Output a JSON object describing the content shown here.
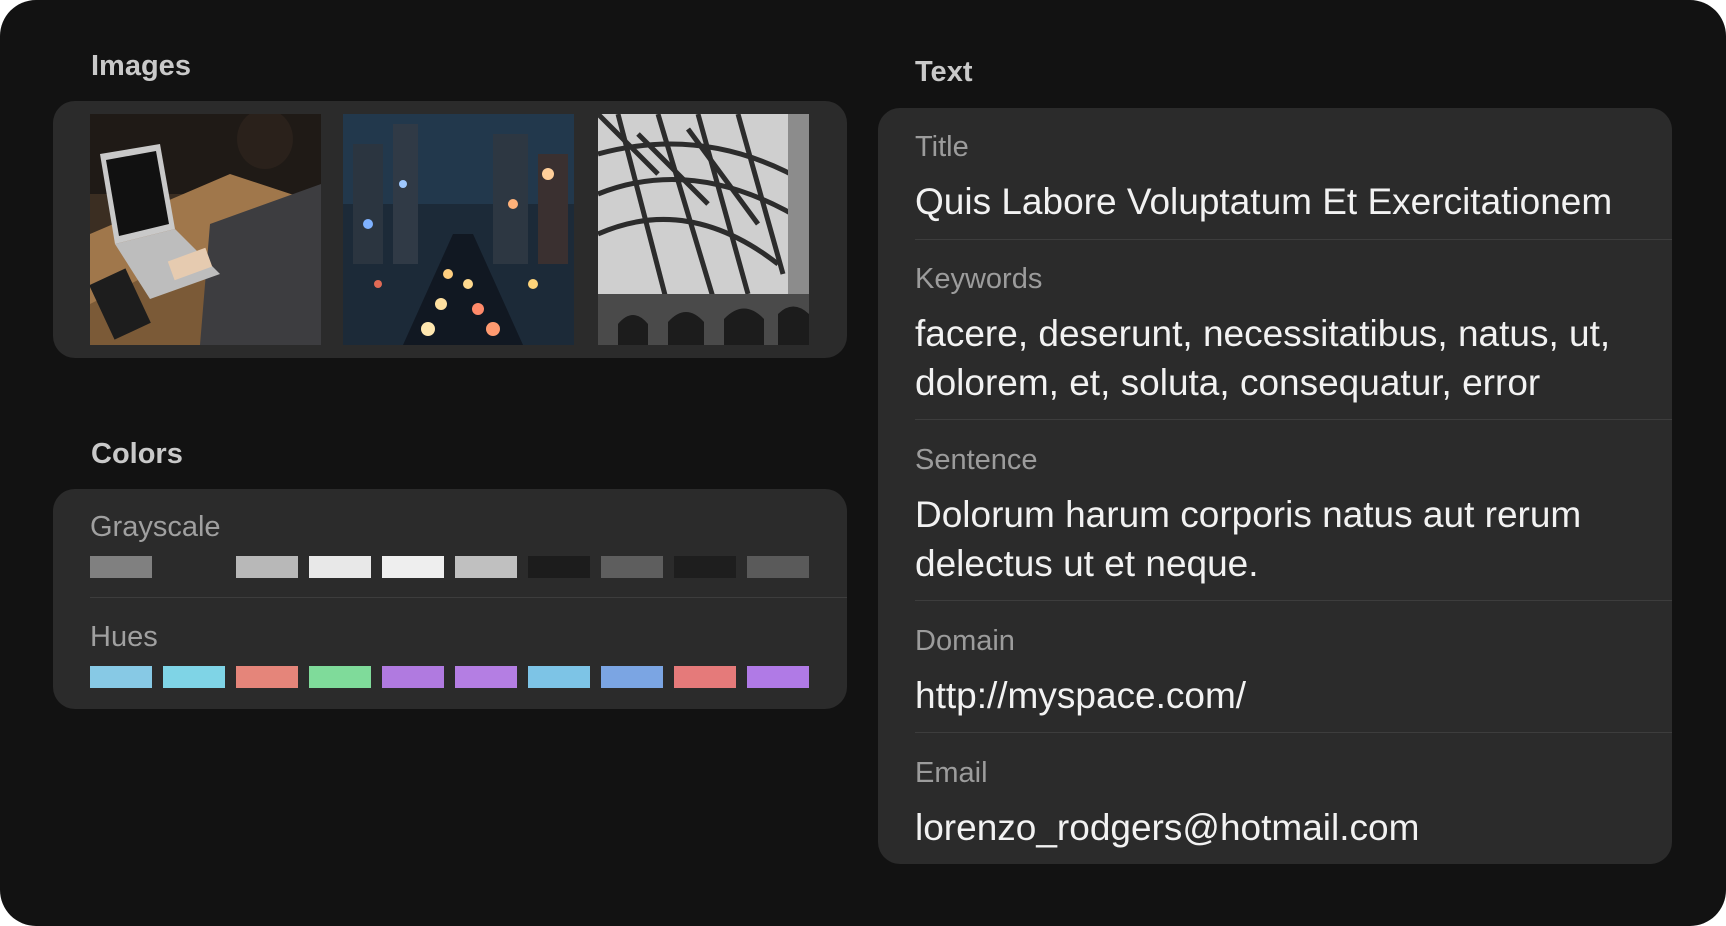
{
  "images": {
    "title": "Images",
    "thumbnails": [
      {
        "icon": "laptop-photo"
      },
      {
        "icon": "city-night-photo"
      },
      {
        "icon": "bridge-structure-photo"
      }
    ]
  },
  "colors": {
    "title": "Colors",
    "grayscale": {
      "label": "Grayscale",
      "swatches": [
        "#808080",
        "#2b2b2b",
        "#b8b8b8",
        "#e8e8e8",
        "#eeeeee",
        "#c0c0c0",
        "#1c1c1c",
        "#5e5e5e",
        "#1e1e1e",
        "#5a5a5a"
      ]
    },
    "hues": {
      "label": "Hues",
      "swatches": [
        "#87c9e5",
        "#7fd4e6",
        "#e5857a",
        "#7fdb9a",
        "#b07ae0",
        "#b47ee3",
        "#7dc4e6",
        "#7ba5e3",
        "#e57a7a",
        "#b07ae6"
      ]
    }
  },
  "text": {
    "title": "Text",
    "fields": [
      {
        "label": "Title",
        "value": "Quis Labore Voluptatum Et Exercitationem"
      },
      {
        "label": "Keywords",
        "value": "facere, deserunt, necessitatibus, natus, ut, dolorem, et, soluta, consequatur, error"
      },
      {
        "label": "Sentence",
        "value": "Dolorum harum corporis natus aut rerum delectus ut et neque."
      },
      {
        "label": "Domain",
        "value": "http://myspace.com/"
      },
      {
        "label": "Email",
        "value": "lorenzo_rodgers@hotmail.com"
      }
    ]
  }
}
